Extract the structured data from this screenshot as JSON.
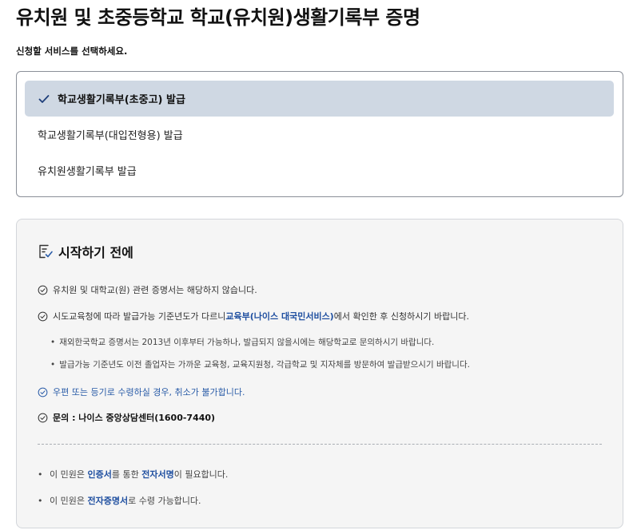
{
  "page": {
    "title": "유치원 및 초중등학교 학교(유치원)생활기록부 증명",
    "prompt": "신청할 서비스를 선택하세요."
  },
  "options": [
    {
      "label": "학교생활기록부(초중고) 발급",
      "selected": true
    },
    {
      "label": "학교생활기록부(대입전형용) 발급",
      "selected": false
    },
    {
      "label": "유치원생활기록부 발급",
      "selected": false
    }
  ],
  "before_start": {
    "title": "시작하기 전에",
    "item1": "유치원 및 대학교(원) 관련 증명서는 해당하지 않습니다.",
    "item2_pre": "시도교육청에 따라 발급가능 기준년도가 다르니 ",
    "item2_link": "교육부(나이스 대국민서비스)",
    "item2_post": "에서 확인한 후 신청하시기 바랍니다.",
    "sub1": "재외한국학교 증명서는 2013년 이후부터 가능하나, 발급되지 않을시에는 해당학교로 문의하시기 바랍니다.",
    "sub2": "발급가능 기준년도 이전 졸업자는 가까운 교육청, 교육지원청, 각급학교 및 지자체를 방문하여 발급받으시기 바랍니다.",
    "item3": "우편 또는 등기로 수령하실 경우, 취소가 불가합니다.",
    "item4": "문의 : 나이스 중앙상담센터(1600-7440)",
    "note1_pre": "이 민원은 ",
    "note1_h1": "인증서",
    "note1_mid": "를 통한 ",
    "note1_h2": "전자서명",
    "note1_post": "이 필요합니다.",
    "note2_pre": "이 민원은 ",
    "note2_h": "전자증명서",
    "note2_post": "로 수령 가능합니다."
  },
  "colors": {
    "selected_bg": "#cfd8e3",
    "accent": "#1f4fa0",
    "warning_text": "#2a5ca8"
  },
  "icons": [
    "check-icon",
    "checklist-doc-icon",
    "circle-check-icon"
  ]
}
